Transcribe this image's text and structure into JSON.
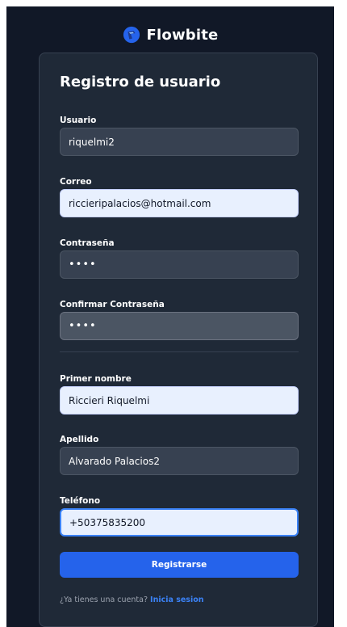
{
  "brand": {
    "name": "Flowbite",
    "logo_icon": "flowbite-logo-icon",
    "logo_color": "#2563eb"
  },
  "form": {
    "title": "Registro de usuario",
    "fields": [
      {
        "label": "Usuario",
        "value": "riquelmi2"
      },
      {
        "label": "Correo",
        "value": "riccieripalacios@hotmail.com"
      },
      {
        "label": "Contraseña",
        "value": "••••"
      },
      {
        "label": "Confirmar Contraseña",
        "value": "••••"
      },
      {
        "label": "Primer nombre",
        "value": "Riccieri Riquelmi"
      },
      {
        "label": "Apellido",
        "value": "Alvarado Palacios2"
      },
      {
        "label": "Teléfono",
        "value": "+50375835200"
      }
    ],
    "submit_label": "Registrarse",
    "footer_text": "¿Ya tienes una cuenta?",
    "footer_link": "Inicia sesion"
  },
  "colors": {
    "page_background": "#111827",
    "card_background": "#1f2937",
    "accent": "#2563eb",
    "link": "#3b82f6"
  }
}
